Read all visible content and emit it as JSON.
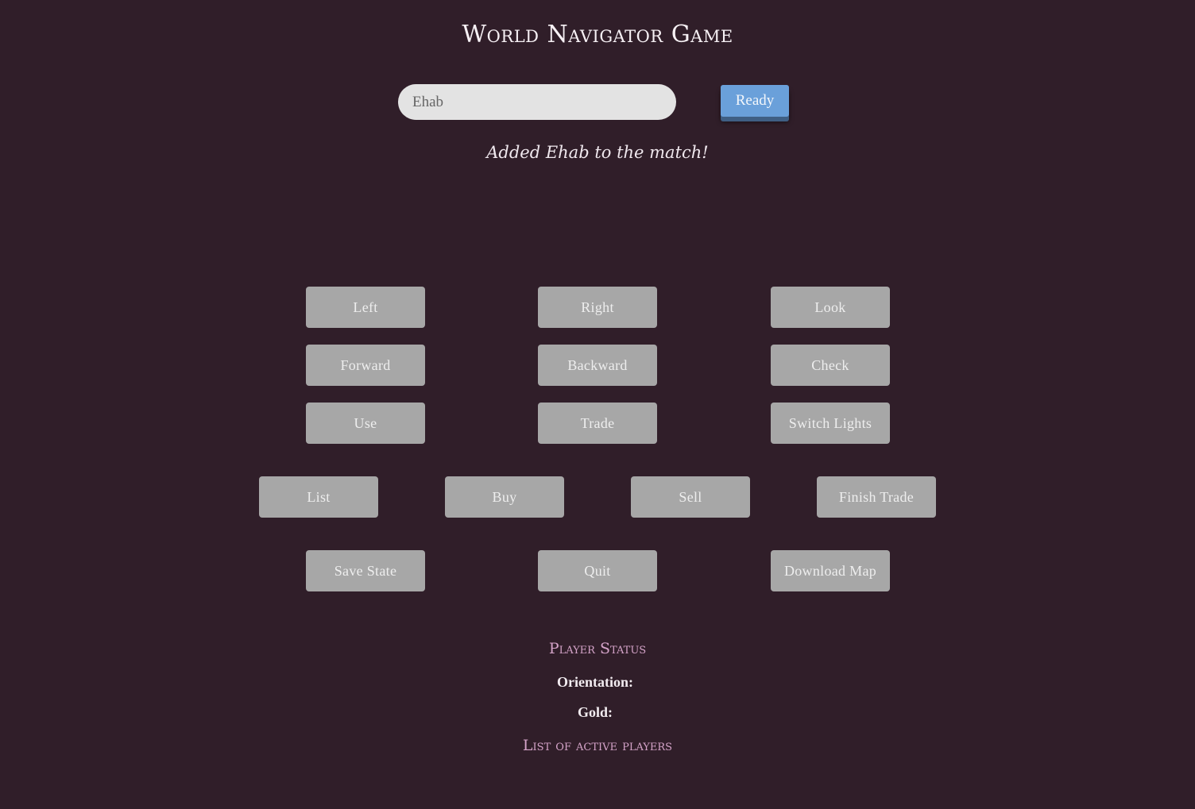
{
  "header": {
    "title": "World Navigator Game"
  },
  "join": {
    "name_value": "Ehab",
    "ready_label": "Ready"
  },
  "message": "Added Ehab to the match!",
  "controls": {
    "left": "Left",
    "right": "Right",
    "look": "Look",
    "forward": "Forward",
    "backward": "Backward",
    "check": "Check",
    "use": "Use",
    "trade": "Trade",
    "switch_lights": "Switch Lights",
    "list": "List",
    "buy": "Buy",
    "sell": "Sell",
    "finish_trade": "Finish Trade",
    "save_state": "Save State",
    "quit": "Quit",
    "download_map": "Download Map"
  },
  "status": {
    "heading": "Player Status",
    "orientation_label": "Orientation:",
    "gold_label": "Gold:"
  },
  "players": {
    "heading": "List of active players"
  },
  "colors": {
    "background": "#301e29",
    "button": "#a7a7a7",
    "ready_button": "#6aa0da",
    "accent_heading": "#d4a3c8"
  }
}
